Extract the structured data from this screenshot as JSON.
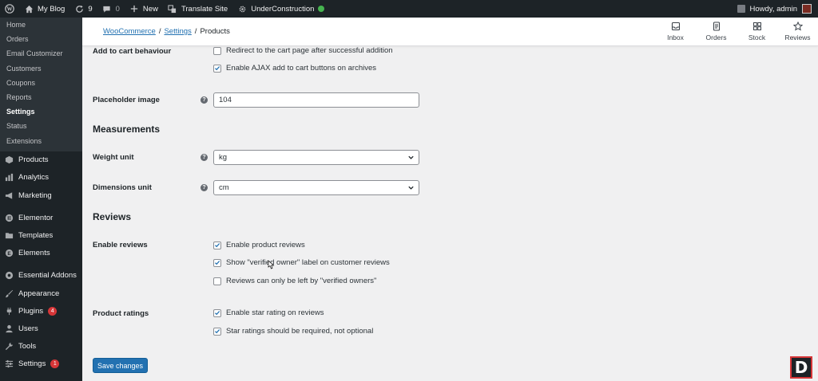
{
  "adminbar": {
    "site_name": "My Blog",
    "updates_count": "9",
    "comments_count": "0",
    "new_label": "New",
    "translate_label": "Translate Site",
    "construction_label": "UnderConstruction",
    "howdy": "Howdy, admin"
  },
  "sidebar": {
    "submenu": [
      "Home",
      "Orders",
      "Email Customizer",
      "Customers",
      "Coupons",
      "Reports",
      "Settings",
      "Status",
      "Extensions"
    ],
    "menu": {
      "products": "Products",
      "analytics": "Analytics",
      "marketing": "Marketing",
      "elementor": "Elementor",
      "templates": "Templates",
      "elements": "Elements",
      "essential_addons": "Essential Addons",
      "appearance": "Appearance",
      "plugins": "Plugins",
      "plugins_badge": "4",
      "users": "Users",
      "tools": "Tools",
      "settings": "Settings",
      "settings_badge": "1"
    }
  },
  "header": {
    "breadcrumb": {
      "woocommerce": "WooCommerce",
      "sep": "/",
      "settings": "Settings",
      "products": "Products"
    },
    "actions": {
      "inbox": "Inbox",
      "orders": "Orders",
      "stock": "Stock",
      "reviews": "Reviews"
    }
  },
  "form": {
    "add_to_cart_label": "Add to cart behaviour",
    "redirect_label": "Redirect to the cart page after successful addition",
    "ajax_label": "Enable AJAX add to cart buttons on archives",
    "placeholder_label": "Placeholder image",
    "placeholder_value": "104",
    "measurements_heading": "Measurements",
    "weight_label": "Weight unit",
    "weight_value": "kg",
    "dimensions_label": "Dimensions unit",
    "dimensions_value": "cm",
    "reviews_heading": "Reviews",
    "enable_reviews_label": "Enable reviews",
    "enable_product_reviews": "Enable product reviews",
    "verified_owner_label": "Show \"verified owner\" label on customer reviews",
    "verified_only": "Reviews can only be left by \"verified owners\"",
    "product_ratings_label": "Product ratings",
    "enable_star_rating": "Enable star rating on reviews",
    "star_required": "Star ratings should be required, not optional",
    "save_button": "Save changes",
    "help_glyph": "?"
  },
  "logo_letter": "D",
  "colors": {
    "adminbar": "#1d2327",
    "accent": "#2271b1",
    "badge": "#d63638"
  }
}
